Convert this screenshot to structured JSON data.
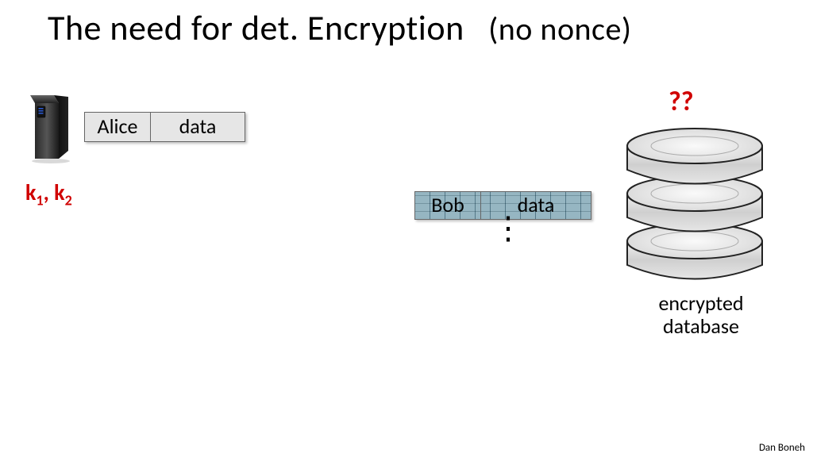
{
  "title": {
    "main": "The need for det. Encryption",
    "note": "(no nonce)"
  },
  "alice_record": {
    "name": "Alice",
    "data": "data"
  },
  "bob_record": {
    "name": "Bob",
    "data": "data"
  },
  "keys_label_parts": {
    "k": "k",
    "sep": ", ",
    "s1": "1",
    "s2": "2"
  },
  "question_marks": "??",
  "db_label_line1": "encrypted",
  "db_label_line2": "database",
  "vdots": "⋮",
  "author": "Dan Boneh"
}
